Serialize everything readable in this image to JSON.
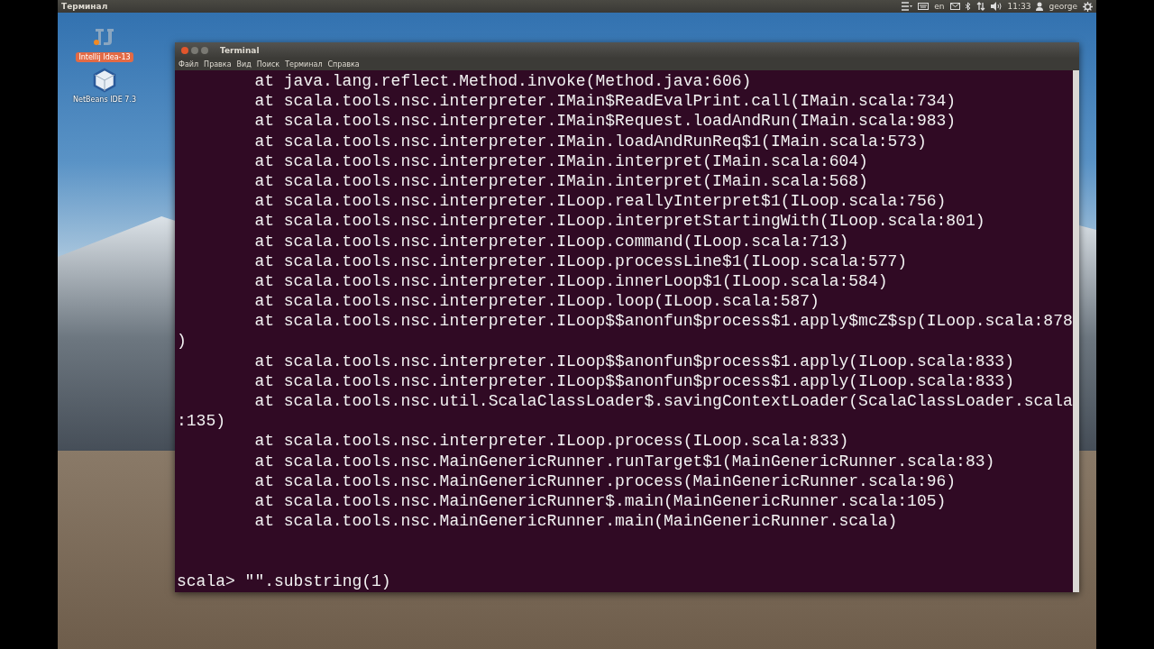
{
  "top_panel": {
    "app_title": "Терминал",
    "keyboard_layout": "en",
    "time": "11:33",
    "user": "george"
  },
  "desktop_icons": [
    {
      "kind": "intellij",
      "label": "Intellij Idea-13",
      "selected": true
    },
    {
      "kind": "netbeans",
      "label": "NetBeans IDE 7.3",
      "selected": false
    }
  ],
  "terminal": {
    "title": "Terminal",
    "menu": [
      "Файл",
      "Правка",
      "Вид",
      "Поиск",
      "Терминал",
      "Справка"
    ],
    "lines": [
      {
        "kind": "frame",
        "text": "at java.lang.reflect.Method.invoke(Method.java:606)"
      },
      {
        "kind": "frame",
        "text": "at scala.tools.nsc.interpreter.IMain$ReadEvalPrint.call(IMain.scala:734)"
      },
      {
        "kind": "frame",
        "text": "at scala.tools.nsc.interpreter.IMain$Request.loadAndRun(IMain.scala:983)"
      },
      {
        "kind": "frame",
        "text": "at scala.tools.nsc.interpreter.IMain.loadAndRunReq$1(IMain.scala:573)"
      },
      {
        "kind": "frame",
        "text": "at scala.tools.nsc.interpreter.IMain.interpret(IMain.scala:604)"
      },
      {
        "kind": "frame",
        "text": "at scala.tools.nsc.interpreter.IMain.interpret(IMain.scala:568)"
      },
      {
        "kind": "frame",
        "text": "at scala.tools.nsc.interpreter.ILoop.reallyInterpret$1(ILoop.scala:756)"
      },
      {
        "kind": "frame",
        "text": "at scala.tools.nsc.interpreter.ILoop.interpretStartingWith(ILoop.scala:801)"
      },
      {
        "kind": "frame",
        "text": "at scala.tools.nsc.interpreter.ILoop.command(ILoop.scala:713)"
      },
      {
        "kind": "frame",
        "text": "at scala.tools.nsc.interpreter.ILoop.processLine$1(ILoop.scala:577)"
      },
      {
        "kind": "frame",
        "text": "at scala.tools.nsc.interpreter.ILoop.innerLoop$1(ILoop.scala:584)"
      },
      {
        "kind": "frame",
        "text": "at scala.tools.nsc.interpreter.ILoop.loop(ILoop.scala:587)"
      },
      {
        "kind": "frame",
        "text": "at scala.tools.nsc.interpreter.ILoop$$anonfun$process$1.apply$mcZ$sp(ILoop.scala:878"
      },
      {
        "kind": "wrap",
        "text": ")"
      },
      {
        "kind": "frame",
        "text": "at scala.tools.nsc.interpreter.ILoop$$anonfun$process$1.apply(ILoop.scala:833)"
      },
      {
        "kind": "frame",
        "text": "at scala.tools.nsc.interpreter.ILoop$$anonfun$process$1.apply(ILoop.scala:833)"
      },
      {
        "kind": "frame",
        "text": "at scala.tools.nsc.util.ScalaClassLoader$.savingContextLoader(ScalaClassLoader.scala"
      },
      {
        "kind": "wrap",
        "text": ":135)"
      },
      {
        "kind": "frame",
        "text": "at scala.tools.nsc.interpreter.ILoop.process(ILoop.scala:833)"
      },
      {
        "kind": "frame",
        "text": "at scala.tools.nsc.MainGenericRunner.runTarget$1(MainGenericRunner.scala:83)"
      },
      {
        "kind": "frame",
        "text": "at scala.tools.nsc.MainGenericRunner.process(MainGenericRunner.scala:96)"
      },
      {
        "kind": "frame",
        "text": "at scala.tools.nsc.MainGenericRunner$.main(MainGenericRunner.scala:105)"
      },
      {
        "kind": "frame",
        "text": "at scala.tools.nsc.MainGenericRunner.main(MainGenericRunner.scala)"
      },
      {
        "kind": "blank"
      },
      {
        "kind": "blank"
      },
      {
        "kind": "prompt",
        "text": "scala> \"\".substring(1)"
      }
    ]
  }
}
